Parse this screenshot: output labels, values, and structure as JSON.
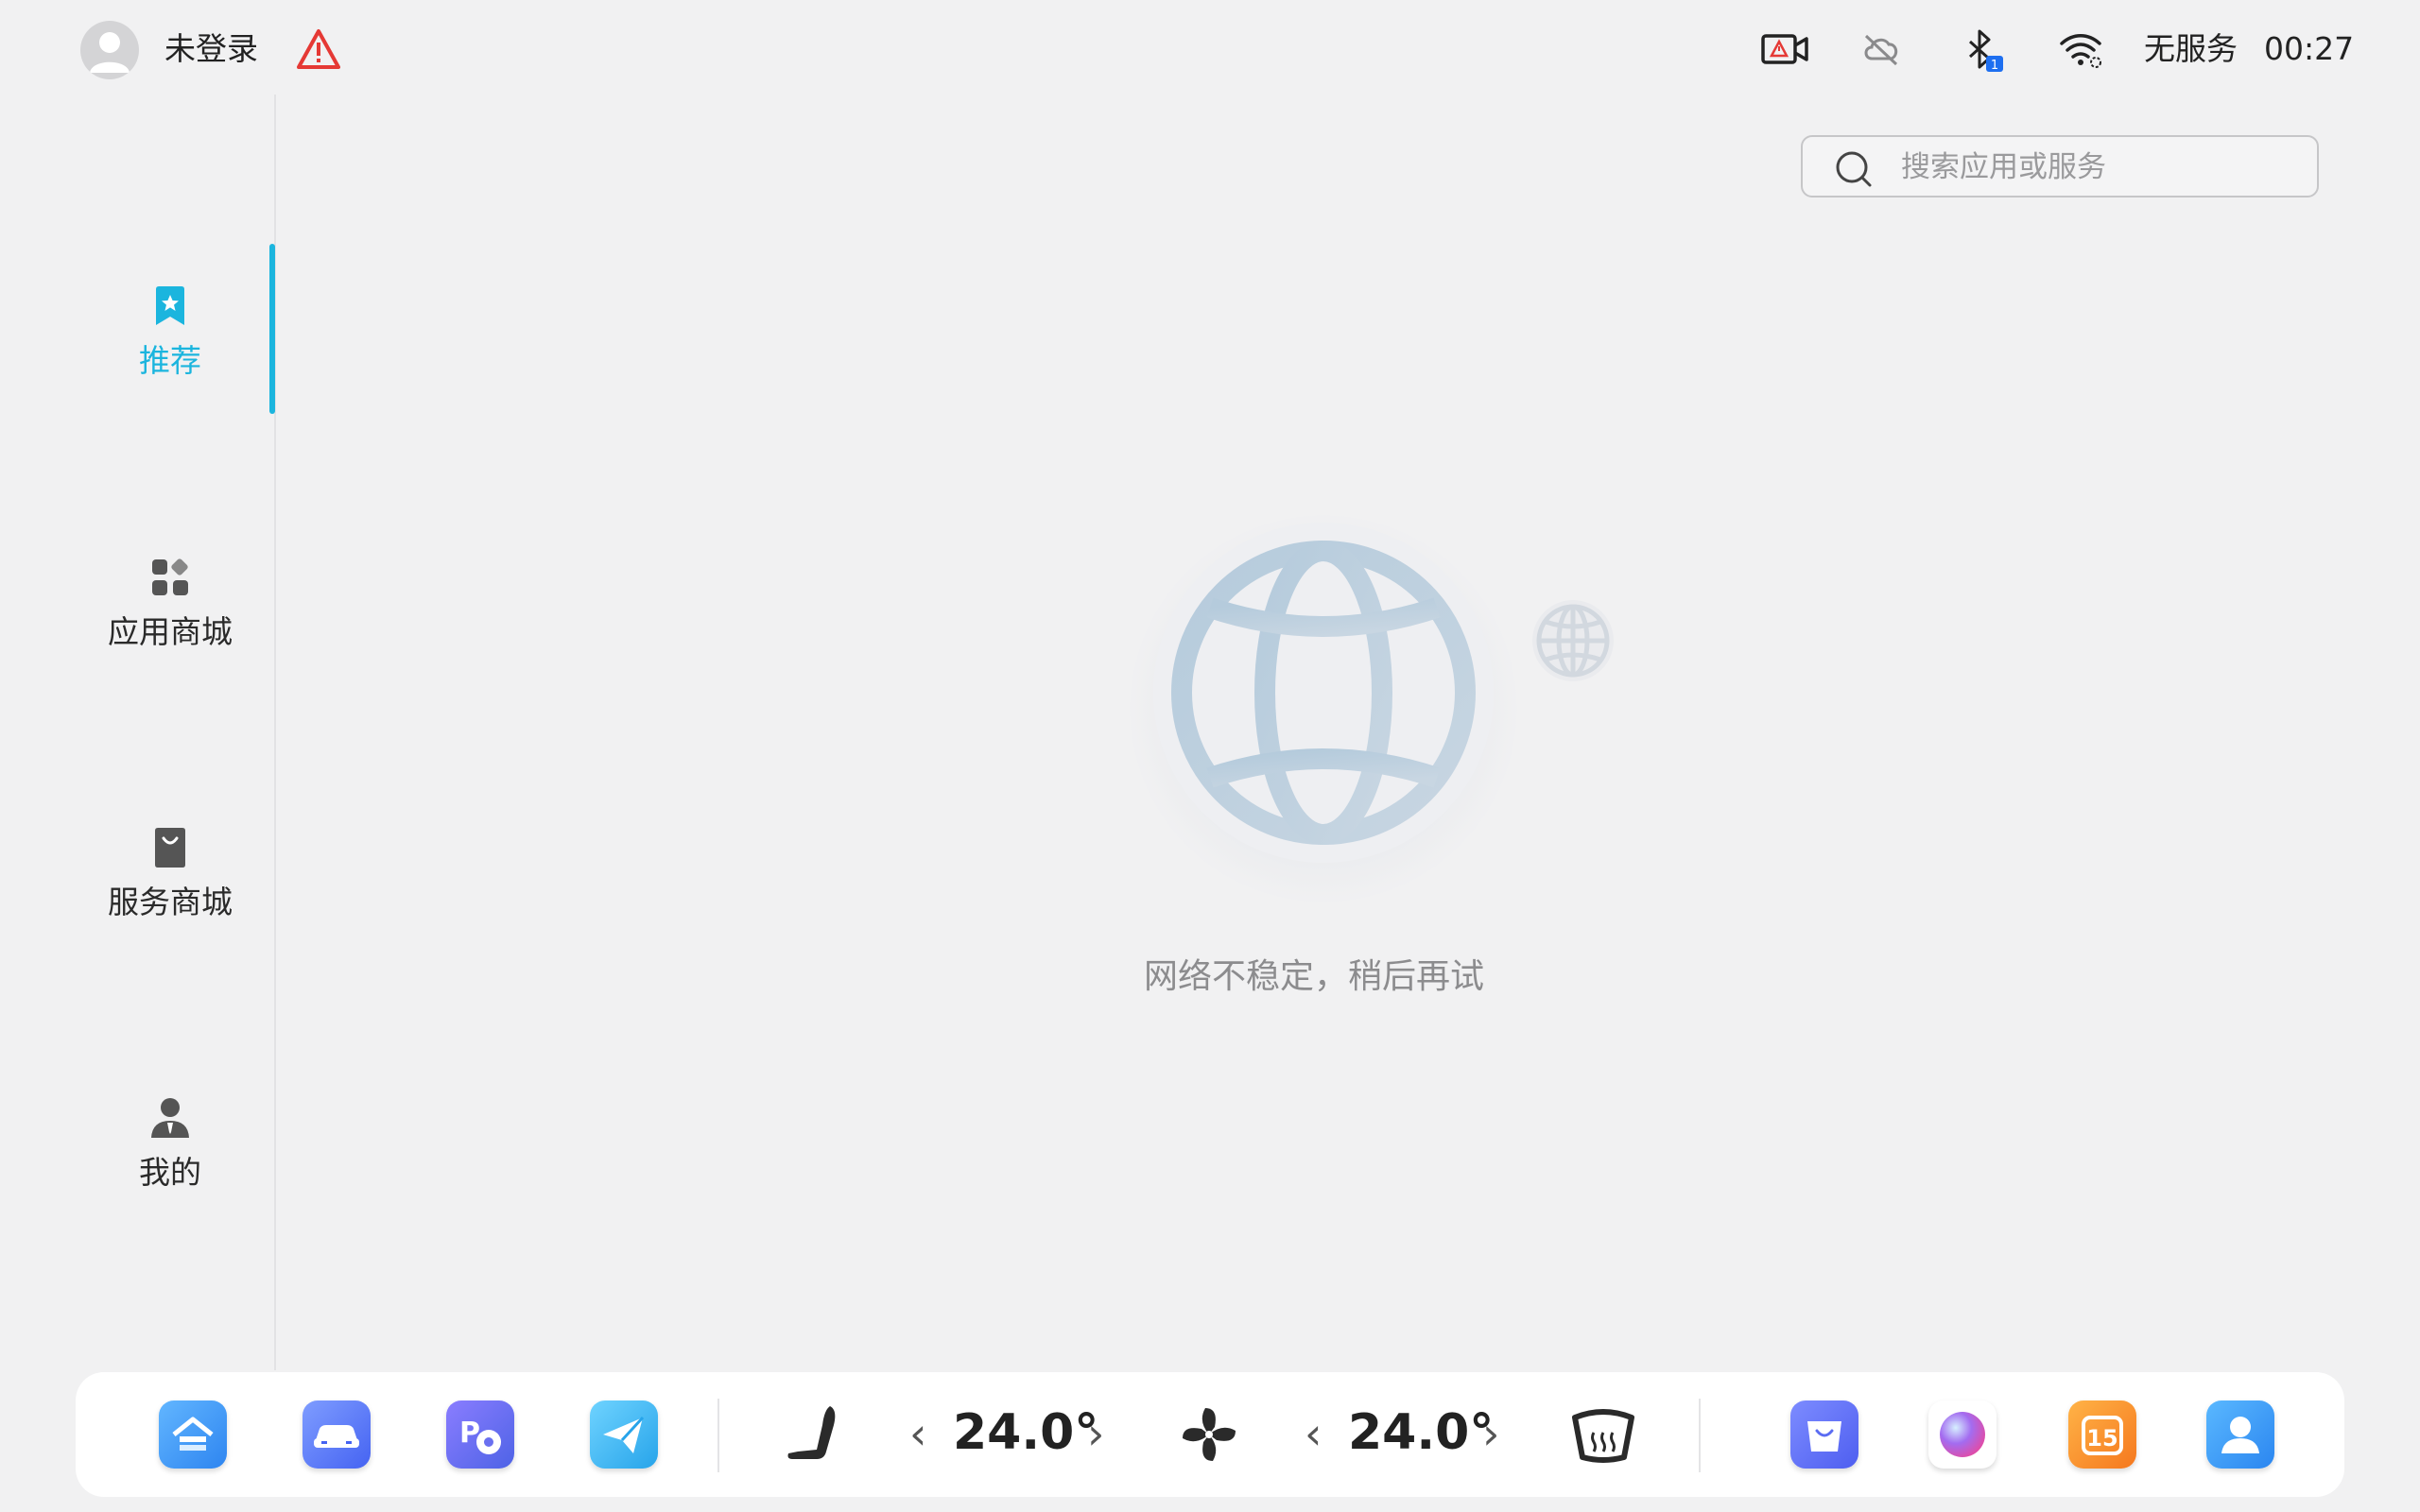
{
  "status_bar": {
    "login_label": "未登录",
    "network_status": "无服务",
    "time": "00:27",
    "bluetooth_badge": "1"
  },
  "sidebar": {
    "items": [
      {
        "label": "推荐",
        "icon": "bookmark-star-icon",
        "active": true
      },
      {
        "label": "应用商城",
        "icon": "apps-grid-icon",
        "active": false
      },
      {
        "label": "服务商城",
        "icon": "shopping-bag-icon",
        "active": false
      },
      {
        "label": "我的",
        "icon": "user-icon",
        "active": false
      }
    ]
  },
  "search": {
    "placeholder": "搜索应用或服务"
  },
  "empty_state": {
    "message": "网络不稳定，稍后再试",
    "icon": "globe-icon"
  },
  "dock": {
    "left_apps": [
      "home-app-icon",
      "car-app-icon",
      "parking-app-icon",
      "navigation-app-icon"
    ],
    "climate": {
      "left_temp": "24.0°",
      "right_temp": "24.0°",
      "icons": [
        "seat-icon",
        "fan-icon",
        "rear-defrost-icon"
      ]
    },
    "right_apps": [
      "app-store-icon",
      "voice-assistant-icon",
      "calendar-app-icon",
      "contacts-app-icon"
    ],
    "calendar_day": "15"
  },
  "colors": {
    "accent": "#1bb5de",
    "background": "#f1f1f2",
    "warning": "#e53935"
  }
}
